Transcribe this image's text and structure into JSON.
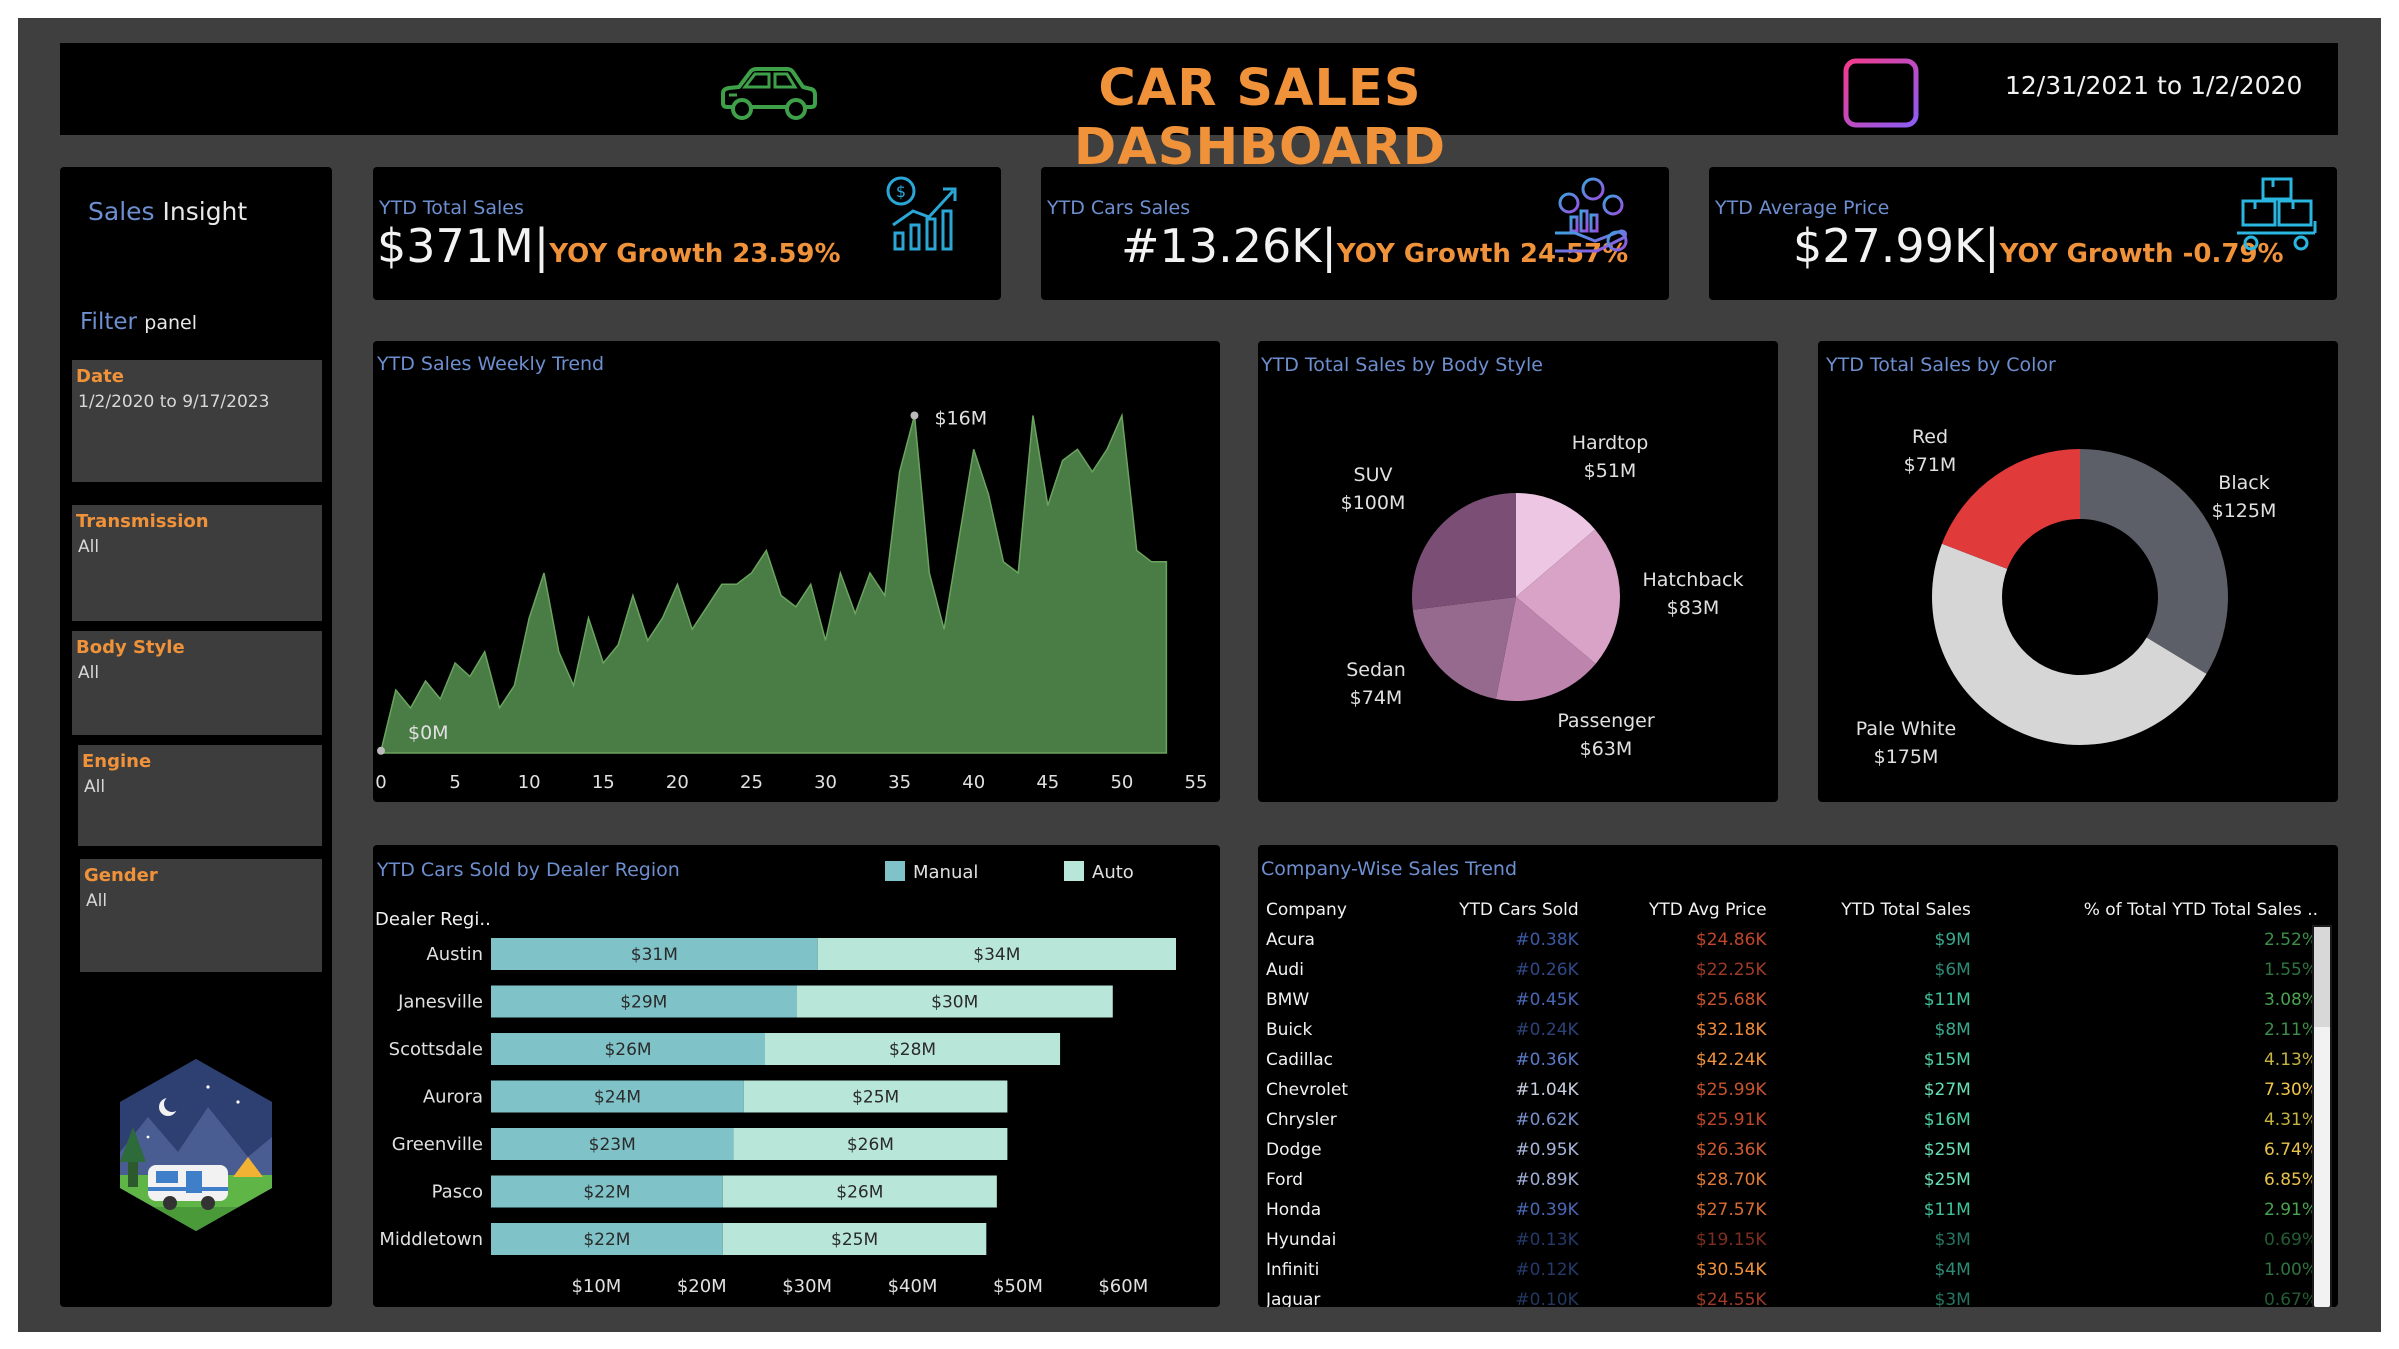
{
  "header": {
    "title": "CAR SALES DASHBOARD",
    "date_range": "12/31/2021 to 1/2/2020"
  },
  "sidebar": {
    "insight": {
      "prefix": "Sales",
      "suffix": "Insight"
    },
    "filter": {
      "prefix": "Filter",
      "suffix": "panel"
    },
    "filters": [
      {
        "label": "Date",
        "value": "1/2/2020 to 9/17/2023"
      },
      {
        "label": "Transmission",
        "value": "All"
      },
      {
        "label": "Body Style",
        "value": "All"
      },
      {
        "label": "Engine",
        "value": "All"
      },
      {
        "label": "Gender",
        "value": "All"
      }
    ]
  },
  "kpis": [
    {
      "label": "YTD Total Sales",
      "value": "$371M",
      "yoy": "YOY Growth 23.59%",
      "icon": "bar-chart-dollar-icon"
    },
    {
      "label": "YTD Cars Sales",
      "value": "#13.26K",
      "yoy": "YOY Growth 24.57%",
      "icon": "coins-hand-icon"
    },
    {
      "label": "YTD Average Price",
      "value": "$27.99K",
      "yoy": "YOY Growth -0.79%",
      "icon": "boxes-trolley-icon"
    }
  ],
  "weekly_trend": {
    "title": "YTD Sales Weekly Trend",
    "max_label": "$16M",
    "min_label": "$0M",
    "x_ticks": [
      "0",
      "5",
      "10",
      "15",
      "20",
      "25",
      "30",
      "35",
      "40",
      "45",
      "50",
      "55"
    ]
  },
  "body_style": {
    "title": "YTD Total Sales by Body Style",
    "slices": [
      {
        "name": "Hardtop",
        "value": "$51M",
        "color": "#ecc6e2"
      },
      {
        "name": "Hatchback",
        "value": "$83M",
        "color": "#d9a3c8"
      },
      {
        "name": "Passenger",
        "value": "$63M",
        "color": "#bd85ad"
      },
      {
        "name": "Sedan",
        "value": "$74M",
        "color": "#96698f"
      },
      {
        "name": "SUV",
        "value": "$100M",
        "color": "#7a4e75"
      }
    ]
  },
  "color_sales": {
    "title": "YTD Total Sales by Color",
    "slices": [
      {
        "name": "Black",
        "value": "$125M",
        "color": "#5c5f68"
      },
      {
        "name": "Pale White",
        "value": "$175M",
        "color": "#d6d6d6"
      },
      {
        "name": "Red",
        "value": "$71M",
        "color": "#e03a3a"
      }
    ]
  },
  "dealer_region": {
    "title": "YTD Cars Sold by Dealer Region",
    "legend": [
      {
        "name": "Manual",
        "color": "#7fc3c9"
      },
      {
        "name": "Auto",
        "color": "#b8e6d8"
      }
    ],
    "axis_label": "Dealer Regi..",
    "x_ticks": [
      "$10M",
      "$20M",
      "$30M",
      "$40M",
      "$50M",
      "$60M"
    ]
  },
  "company_trend": {
    "title": "Company-Wise Sales Trend",
    "columns": [
      "Company",
      "YTD Cars Sold",
      "YTD Avg Price",
      "YTD Total Sales",
      "% of Total YTD Total Sales .."
    ],
    "rows": [
      [
        "Acura",
        "#0.38K",
        "$24.86K",
        "$9M",
        "2.52%"
      ],
      [
        "Audi",
        "#0.26K",
        "$22.25K",
        "$6M",
        "1.55%"
      ],
      [
        "BMW",
        "#0.45K",
        "$25.68K",
        "$11M",
        "3.08%"
      ],
      [
        "Buick",
        "#0.24K",
        "$32.18K",
        "$8M",
        "2.11%"
      ],
      [
        "Cadillac",
        "#0.36K",
        "$42.24K",
        "$15M",
        "4.13%"
      ],
      [
        "Chevrolet",
        "#1.04K",
        "$25.99K",
        "$27M",
        "7.30%"
      ],
      [
        "Chrysler",
        "#0.62K",
        "$25.91K",
        "$16M",
        "4.31%"
      ],
      [
        "Dodge",
        "#0.95K",
        "$26.36K",
        "$25M",
        "6.74%"
      ],
      [
        "Ford",
        "#0.89K",
        "$28.70K",
        "$25M",
        "6.85%"
      ],
      [
        "Honda",
        "#0.39K",
        "$27.57K",
        "$11M",
        "2.91%"
      ],
      [
        "Hyundai",
        "#0.13K",
        "$19.15K",
        "$3M",
        "0.69%"
      ],
      [
        "Infiniti",
        "#0.12K",
        "$30.54K",
        "$4M",
        "1.00%"
      ],
      [
        "Jaguar",
        "#0.10K",
        "$24.55K",
        "$3M",
        "0.67%"
      ]
    ],
    "cell_colors": [
      [
        "#3c5aa8",
        "#c0452a",
        "#3aa88e",
        "#3d8f4a"
      ],
      [
        "#2f4887",
        "#9e3a25",
        "#2f8a75",
        "#2f7440"
      ],
      [
        "#4967b5",
        "#c8532d",
        "#3ec49b",
        "#4aa350"
      ],
      [
        "#2c4378",
        "#f08a3a",
        "#3aa88e",
        "#3d8f4a"
      ],
      [
        "#5b7bc9",
        "#f0923a",
        "#4cd1a6",
        "#c5b540"
      ],
      [
        "#c9cfdf",
        "#c8532d",
        "#66e0b8",
        "#f2c84a"
      ],
      [
        "#7a91cc",
        "#c0452a",
        "#4cd1a6",
        "#c5b540"
      ],
      [
        "#a8b6da",
        "#cf5a30",
        "#66e0b8",
        "#e8c24a"
      ],
      [
        "#a0aed6",
        "#e07a35",
        "#66e0b8",
        "#e8c24a"
      ],
      [
        "#4967b5",
        "#d96c33",
        "#3ec49b",
        "#4aa350"
      ],
      [
        "#243a6a",
        "#7d2e1e",
        "#257561",
        "#245c33"
      ],
      [
        "#243a6a",
        "#f0923a",
        "#2f8a75",
        "#2f7440"
      ],
      [
        "#22385f",
        "#9e3a25",
        "#257561",
        "#245c33"
      ]
    ]
  },
  "chart_data": [
    {
      "type": "area",
      "title": "YTD Sales Weekly Trend",
      "xlim": [
        0,
        55
      ],
      "ylim": [
        0,
        16
      ],
      "x": [
        0,
        1,
        2,
        3,
        4,
        5,
        6,
        7,
        8,
        9,
        10,
        11,
        12,
        13,
        14,
        15,
        16,
        17,
        18,
        19,
        20,
        21,
        22,
        23,
        24,
        25,
        26,
        27,
        28,
        29,
        30,
        31,
        32,
        33,
        34,
        35,
        36,
        37,
        38,
        39,
        40,
        41,
        42,
        43,
        44,
        45,
        46,
        47,
        48,
        49,
        50,
        51,
        52,
        53
      ],
      "series": [
        {
          "values": [
            0.1,
            2.8,
            2.0,
            3.2,
            2.4,
            4.0,
            3.4,
            4.5,
            2.0,
            3.0,
            6.0,
            8.0,
            4.5,
            3.0,
            6.0,
            4.0,
            4.8,
            7.0,
            5.0,
            6.0,
            7.5,
            5.5,
            6.5,
            7.5,
            7.5,
            8.0,
            9.0,
            7.0,
            6.5,
            7.5,
            5.0,
            8.0,
            6.2,
            8.0,
            7.0,
            12.5,
            15.0,
            8.0,
            5.5,
            9.5,
            13.5,
            11.5,
            8.5,
            8.0,
            15.0,
            11.0,
            13.0,
            13.5,
            12.5,
            13.5,
            15.0,
            9.0,
            8.5,
            8.5
          ]
        }
      ]
    },
    {
      "type": "pie",
      "title": "YTD Total Sales by Body Style",
      "categories": [
        "Hardtop",
        "Hatchback",
        "Passenger",
        "Sedan",
        "SUV"
      ],
      "values": [
        51,
        83,
        63,
        74,
        100
      ]
    },
    {
      "type": "pie",
      "title": "YTD Total Sales by Color",
      "categories": [
        "Black",
        "Pale White",
        "Red"
      ],
      "values": [
        125,
        175,
        71
      ]
    },
    {
      "type": "bar",
      "title": "YTD Cars Sold by Dealer Region",
      "categories": [
        "Austin",
        "Janesville",
        "Scottsdale",
        "Aurora",
        "Greenville",
        "Pasco",
        "Middletown"
      ],
      "series": [
        {
          "name": "Manual",
          "values": [
            31,
            29,
            26,
            24,
            23,
            22,
            22
          ]
        },
        {
          "name": "Auto",
          "values": [
            34,
            30,
            28,
            25,
            26,
            26,
            25
          ]
        }
      ],
      "xlim": [
        0,
        65
      ],
      "stacked": true
    }
  ]
}
